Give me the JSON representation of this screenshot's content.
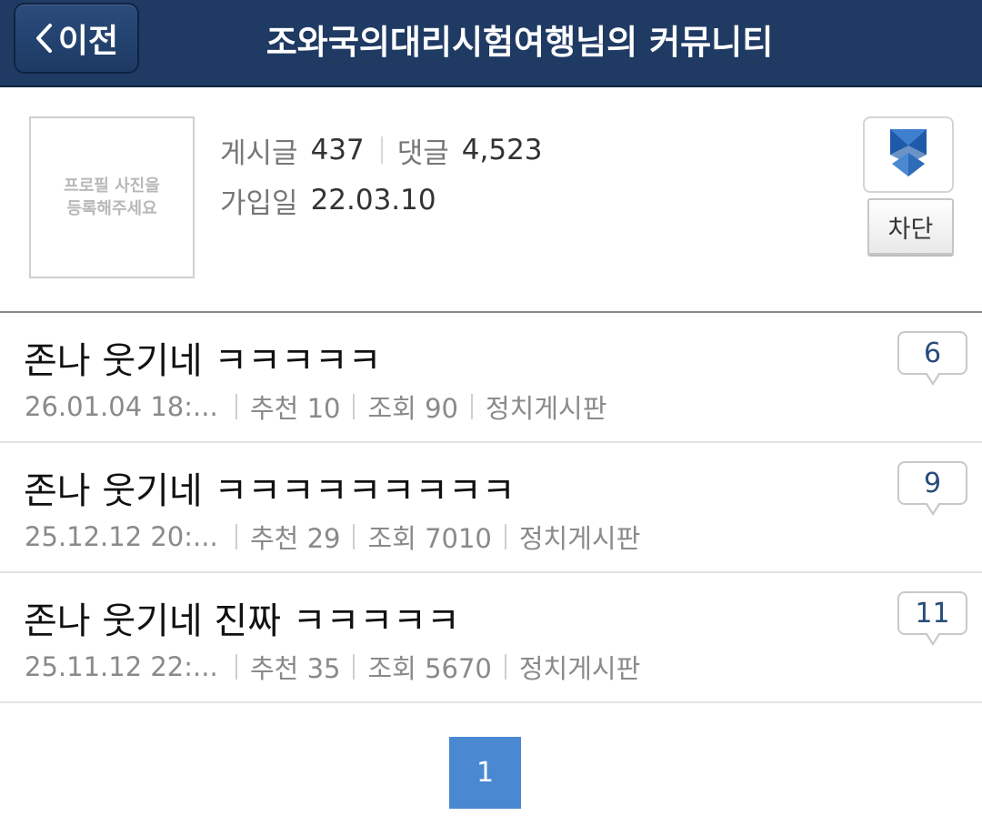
{
  "header": {
    "back_label": "이전",
    "title": "조와국의대리시험여행님의 커뮤니티"
  },
  "profile": {
    "photo_placeholder_line1": "프로필 사진을",
    "photo_placeholder_line2": "등록해주세요",
    "posts_label": "게시글",
    "posts_count": "437",
    "comments_label": "댓글",
    "comments_count": "4,523",
    "joined_label": "가입일",
    "joined_date": "22.03.10",
    "block_label": "차단"
  },
  "posts": [
    {
      "title": "존나 웃기네 ㅋㅋㅋㅋㅋ",
      "date": "26.01.04  18:...",
      "likes": "추천 10",
      "views": "조회 90",
      "board": "정치게시판",
      "comments": "6"
    },
    {
      "title": "존나 웃기네 ㅋㅋㅋㅋㅋㅋㅋㅋㅋ",
      "date": "25.12.12  20:...",
      "likes": "추천 29",
      "views": "조회 7010",
      "board": "정치게시판",
      "comments": "9"
    },
    {
      "title": "존나 웃기네 진짜 ㅋㅋㅋㅋㅋ",
      "date": "25.11.12  22:...",
      "likes": "추천 35",
      "views": "조회 5670",
      "board": "정치게시판",
      "comments": "11"
    }
  ],
  "pagination": {
    "current_page": "1"
  },
  "colors": {
    "header_bg": "#1f3a63",
    "page_button": "#4a88d1",
    "comment_count": "#274d7a"
  }
}
